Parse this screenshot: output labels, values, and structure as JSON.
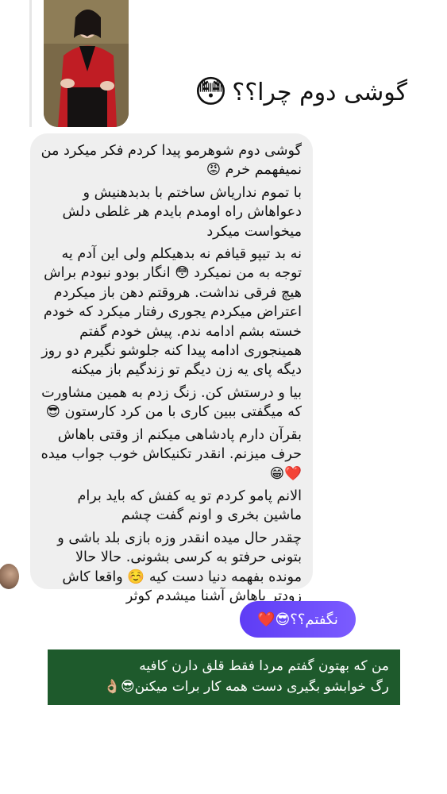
{
  "story_reply": {
    "text": "گوشی دوم چرا؟؟",
    "emoji": "😳"
  },
  "incoming_message": {
    "paragraphs": [
      "گوشی دوم شوهرمو پیدا کردم فکر میکرد من نمیفهمم خرم 😡",
      "با تموم نداریاش ساختم با بدبدهنیش و دعواهاش راه اومدم بایدم هر غلطی دلش میخواست میکرد",
      "نه بد تیپو قیافم نه بدهیکلم ولی این آدم یه توجه به من نمیکرد 😳 انگار بودو نبودم براش هیچ فرقی نداشت. هروقتم دهن باز میکردم اعتراض میکردم یجوری رفتار میکرد که خودم خسته بشم ادامه ندم. پیش خودم گفتم همینجوری ادامه پیدا کنه جلوشو نگیرم دو روز دیگه پای یه زن دیگم تو زندگیم باز میکنه",
      "بیا و درستش کن. زنگ زدم به همین مشاورت که میگفتی ببین کاری با من کرد کارستون 😎",
      "بقرآن دارم پادشاهی میکنم از وقتی باهاش حرف میزنم. انقدر تکنیکاش خوب جواب میده ❤️😁",
      "الانم پامو کردم تو یه کفش که باید برام ماشین بخری و اونم گفت چشم",
      "چقدر حال میده انقدر وزه بازی بلد باشی و بتونی حرفتو به کرسی بشونی. حالا حالا مونده بفهمه دنیا دست کیه ☺️ واقعا کاش زودتر باهاش آشنا میشدم کوثر"
    ]
  },
  "outgoing_message": {
    "text": "نگفتم؟؟😎❤️"
  },
  "banner": {
    "line1": "من که بهتون گفتم مردا فقط قلق دارن کافیه",
    "line2": "رگ خوابشو بگیری دست همه کار برات میکنن😎👌🏼"
  },
  "colors": {
    "incoming_bubble": "#efefef",
    "outgoing_bubble": "#6a4dfc",
    "banner_bg": "#1e5a2c"
  },
  "icons": [
    "story-thumbnail",
    "sender-avatar"
  ]
}
